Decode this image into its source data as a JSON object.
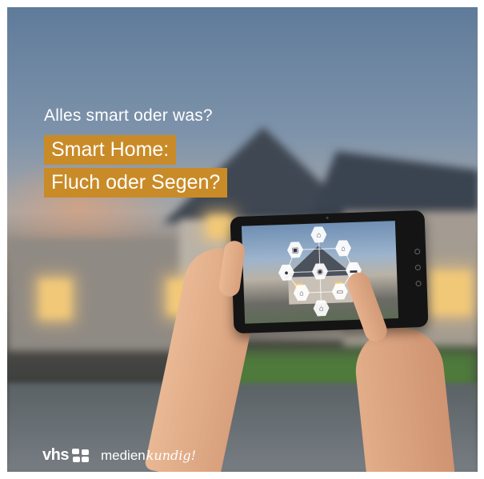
{
  "kicker": "Alles smart oder was?",
  "headline": {
    "line1": "Smart Home:",
    "line2": "Fluch oder Segen?"
  },
  "logos": {
    "vhs": "vhs",
    "medien": "medien",
    "kundig": "kundig!"
  },
  "colors": {
    "accent": "#c98b27",
    "text": "#ffffff"
  },
  "icons": [
    "vhs-logo-icon",
    "smart-home-network-icon"
  ]
}
